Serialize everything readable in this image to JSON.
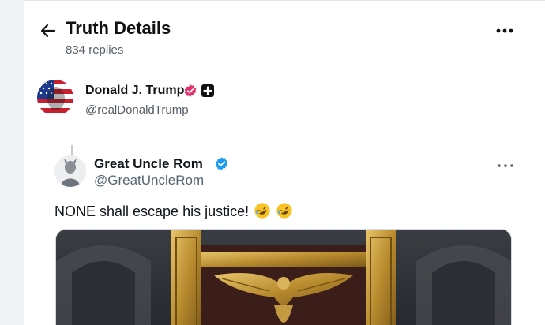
{
  "header": {
    "title": "Truth Details",
    "subtitle": "834 replies"
  },
  "author": {
    "name": "Donald J. Trump",
    "handle": "@realDonaldTrump",
    "verified_color": "#e2336c"
  },
  "embedded_post": {
    "name": "Great Uncle Rom",
    "handle": "@GreatUncleRom",
    "text": "NONE shall escape his justice!",
    "emojis": [
      "rolling-on-floor-laughing",
      "rolling-on-floor-laughing"
    ],
    "verified_color": "#1d9bf0"
  },
  "colors": {
    "accent_gold": "#c9a24a",
    "text_primary": "#111111",
    "text_secondary": "#555d66"
  }
}
